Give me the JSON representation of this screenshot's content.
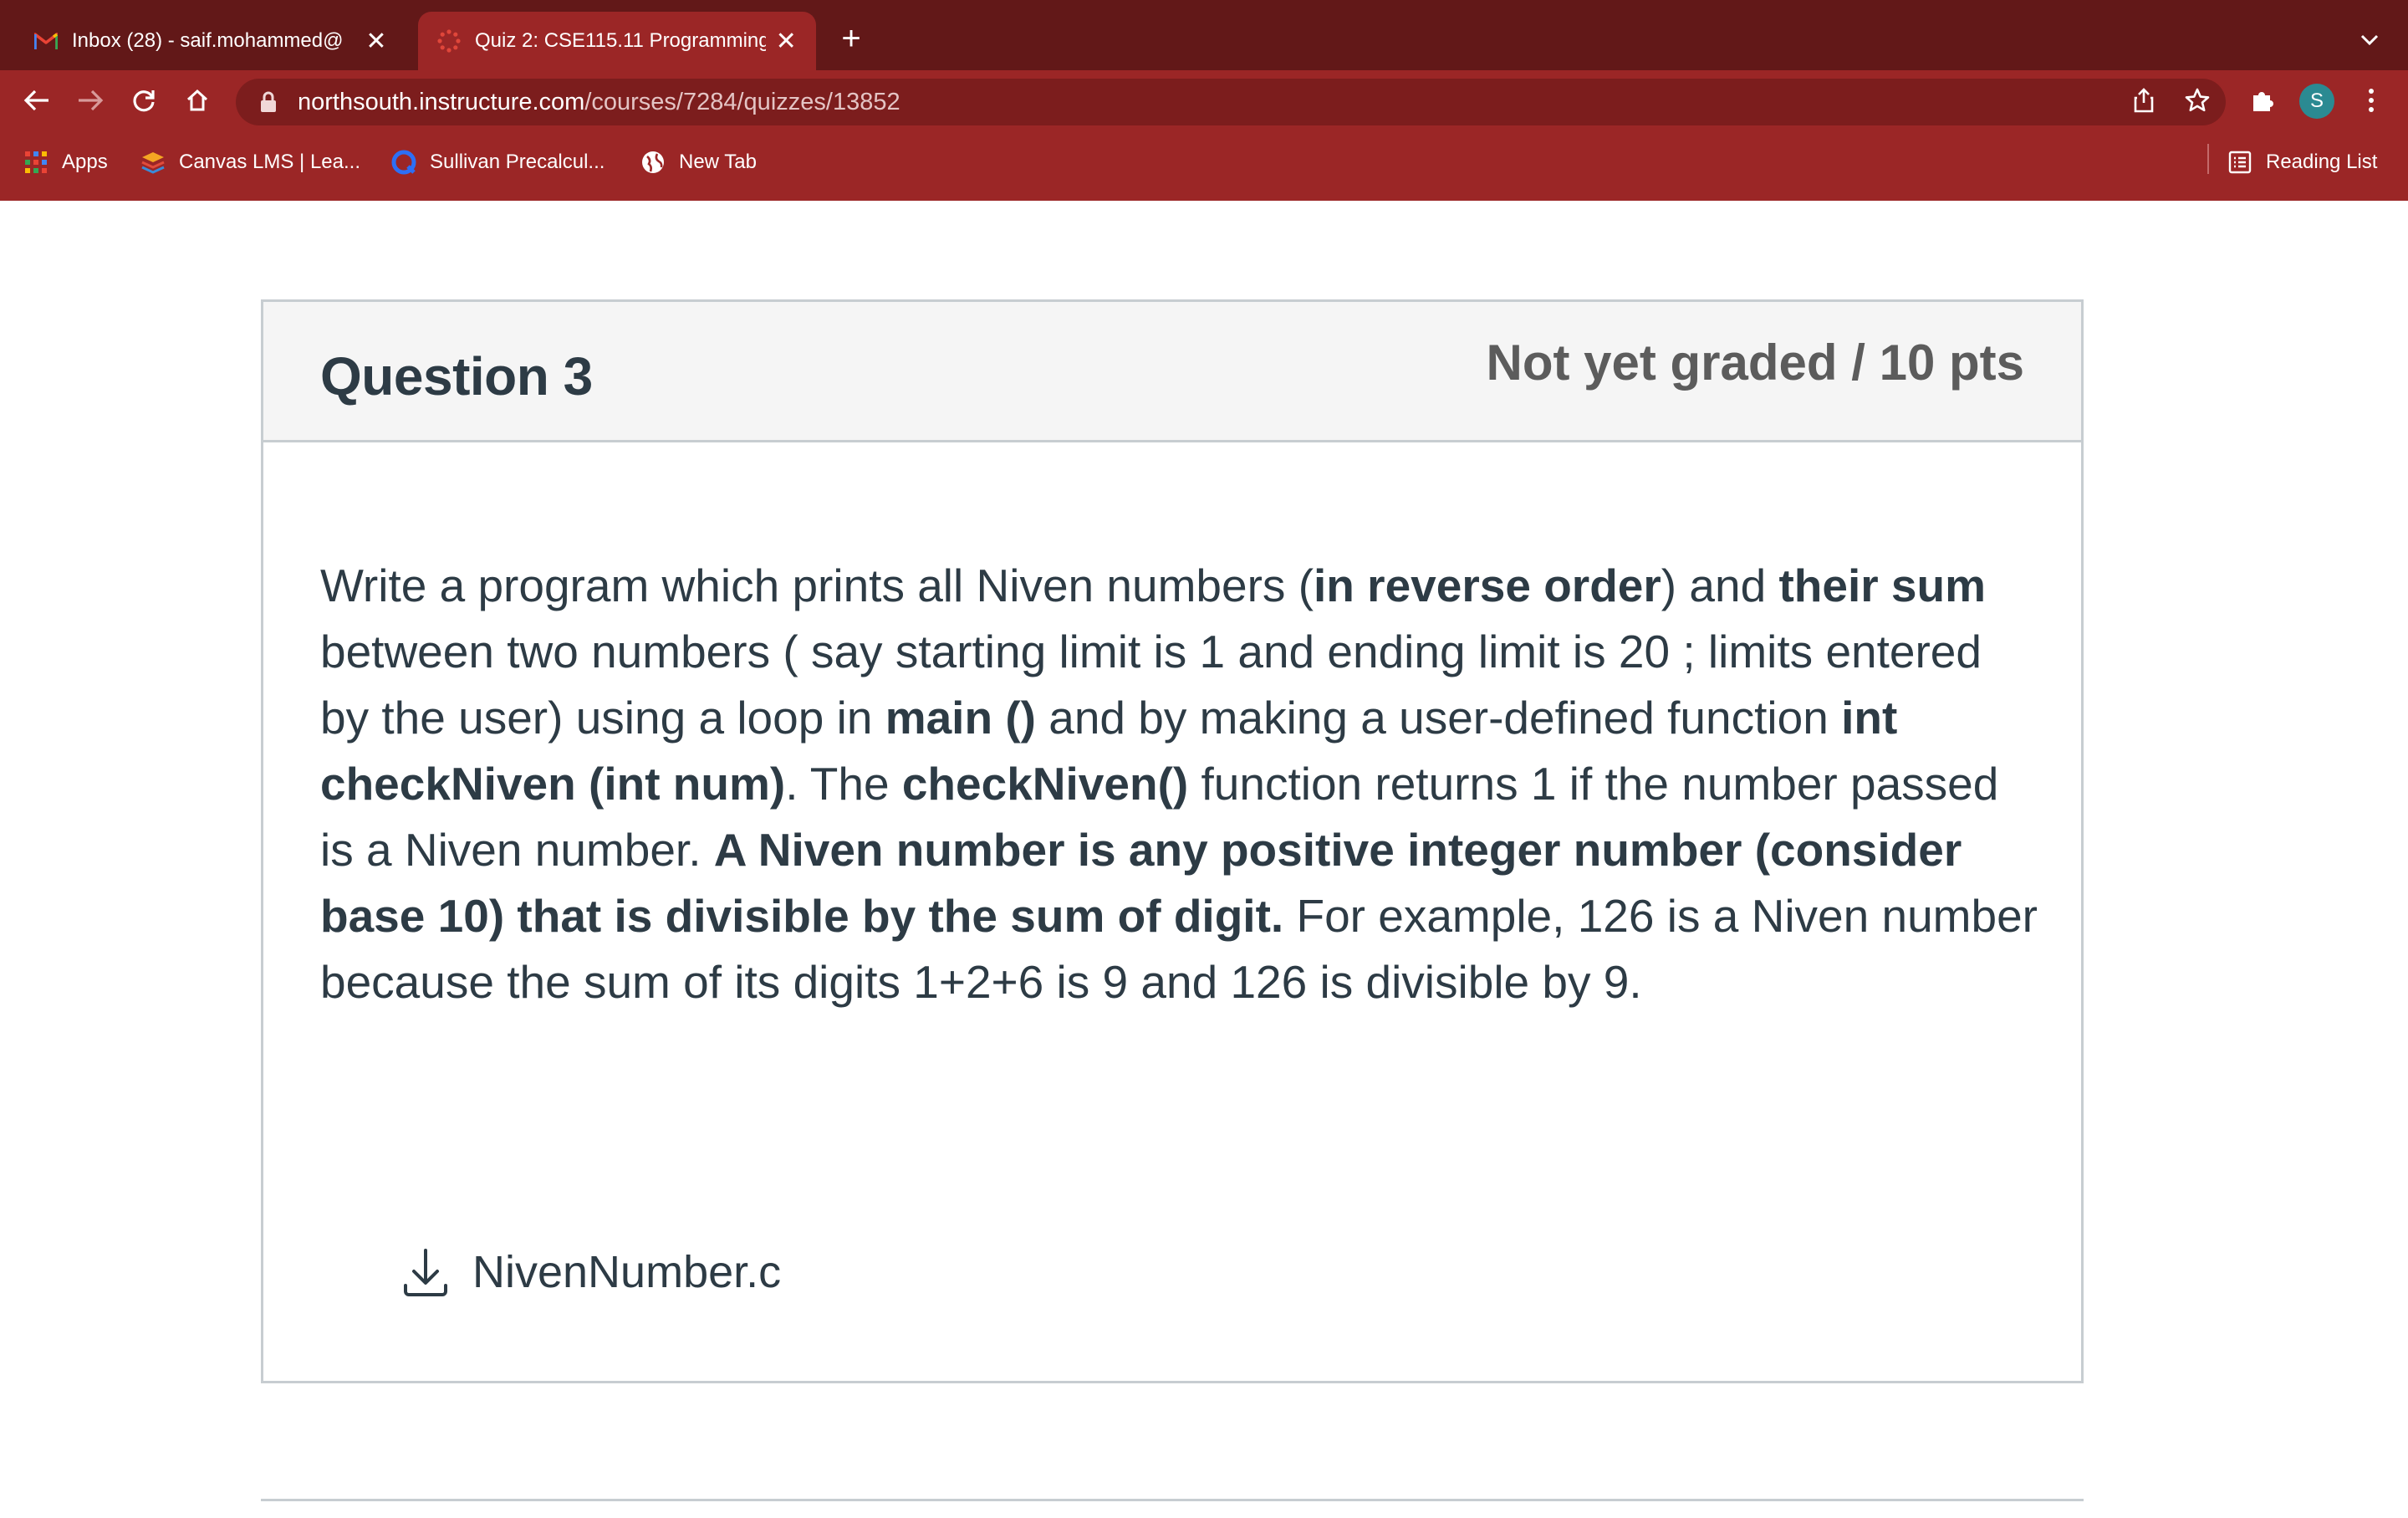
{
  "browser": {
    "tabs": [
      {
        "title": "Inbox (28) - saif.mohammed@",
        "active": false,
        "favicon": "gmail-icon"
      },
      {
        "title": "Quiz 2: CSE115.11 Programming",
        "active": true,
        "favicon": "canvas-icon"
      }
    ],
    "new_tab_symbol": "+",
    "close_symbol": "✕",
    "url_host": "northsouth.instructure.com",
    "url_path": "/courses/7284/quizzes/13852",
    "profile_initial": "S",
    "bookmarks": [
      {
        "label": "Apps",
        "icon": "apps-grid-icon"
      },
      {
        "label": "Canvas LMS | Lea...",
        "icon": "canvas-layers-icon"
      },
      {
        "label": "Sullivan Precalcul...",
        "icon": "q-logo-icon"
      },
      {
        "label": "New Tab",
        "icon": "globe-icon"
      }
    ],
    "reading_list": "Reading List",
    "colors": {
      "tabstrip": "#621818",
      "toolbar": "#9b2626",
      "omnibox": "#7c1d1d",
      "avatar": "#2b8a92"
    }
  },
  "question": {
    "title": "Question 3",
    "points": "Not yet graded / 10 pts",
    "body": [
      {
        "text": "Write a program which prints all Niven numbers (",
        "bold": false
      },
      {
        "text": "in reverse order",
        "bold": true
      },
      {
        "text": ") and ",
        "bold": false
      },
      {
        "text": "their sum",
        "bold": true
      },
      {
        "text": " between two numbers ( say starting limit  is 1 and ending limit  is 20 ; limits entered by the user) using a loop in ",
        "bold": false
      },
      {
        "text": "main ()",
        "bold": true
      },
      {
        "text": " and by making a user-defined function ",
        "bold": false
      },
      {
        "text": "int checkNiven (int num)",
        "bold": true
      },
      {
        "text": ". The ",
        "bold": false
      },
      {
        "text": "checkNiven()",
        "bold": true
      },
      {
        "text": " function returns 1 if the number passed is a Niven number. ",
        "bold": false
      },
      {
        "text": "A Niven number is any positive integer number (consider base 10) that is divisible by the sum of digit.",
        "bold": true
      },
      {
        "text": " For example, 126 is a Niven number because the sum of its digits 1+2+6 is 9 and 126 is divisible by 9.",
        "bold": false
      }
    ],
    "attachment": {
      "filename": "NivenNumber.c",
      "icon": "download-icon"
    }
  }
}
